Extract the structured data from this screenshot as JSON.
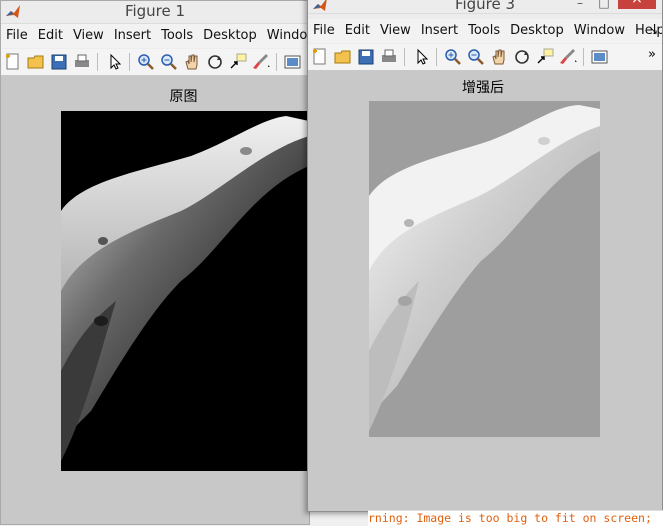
{
  "figure1": {
    "title": "Figure 1",
    "menu": [
      "File",
      "Edit",
      "View",
      "Insert",
      "Tools",
      "Desktop",
      "Window"
    ],
    "axes_title": "原图"
  },
  "figure3": {
    "title": "Figure 3",
    "menu": [
      "File",
      "Edit",
      "View",
      "Insert",
      "Tools",
      "Desktop",
      "Window",
      "Help"
    ],
    "menu_overflow": "↘",
    "toolbar_overflow": "»",
    "axes_title": "增强后",
    "close_glyph": "×"
  },
  "toolbar_icons": [
    "new-figure-icon",
    "open-file-icon",
    "save-icon",
    "print-icon",
    "select-arrow-icon",
    "zoom-in-icon",
    "zoom-out-icon",
    "pan-hand-icon",
    "rotate-3d-icon",
    "data-cursor-icon",
    "brush-icon",
    "colorbar-icon"
  ],
  "command_window": {
    "text": "rning: Image is too big to fit on screen;"
  },
  "colors": {
    "figure_bg": "#c8c8c8",
    "original_bg": "#000000",
    "enhanced_bg": "#9e9e9e",
    "warning": "#e06010"
  }
}
